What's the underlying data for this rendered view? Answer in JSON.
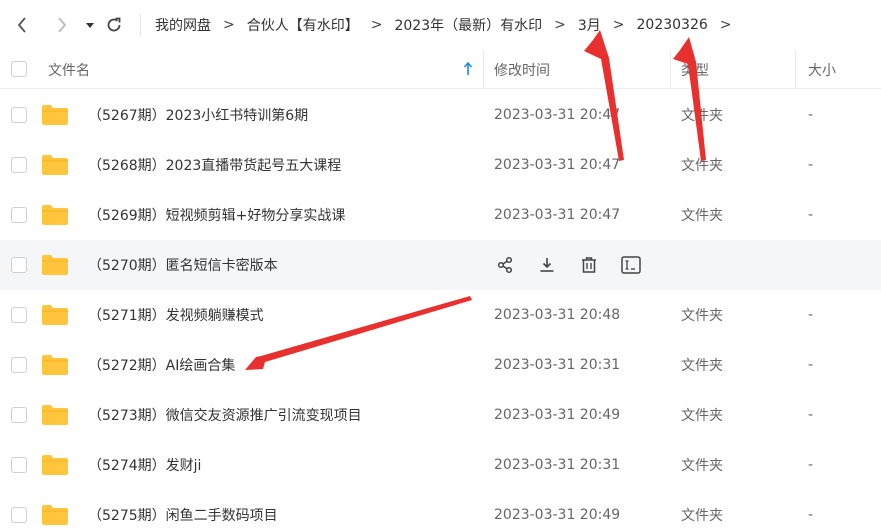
{
  "breadcrumb": {
    "items": [
      "我的网盘",
      "合伙人【有水印】",
      "2023年（最新）有水印",
      "3月",
      "20230326"
    ],
    "separator": ">"
  },
  "columns": {
    "name": "文件名",
    "time": "修改时间",
    "type": "类型",
    "size": "大小"
  },
  "rows": [
    {
      "name": "（5267期）2023小红书特训第6期",
      "time": "2023-03-31 20:47",
      "type": "文件夹",
      "size": "-"
    },
    {
      "name": "（5268期）2023直播带货起号五大课程",
      "time": "2023-03-31 20:47",
      "type": "文件夹",
      "size": "-"
    },
    {
      "name": "（5269期）短视频剪辑+好物分享实战课",
      "time": "2023-03-31 20:47",
      "type": "文件夹",
      "size": "-"
    },
    {
      "name": "（5270期）匿名短信卡密版本",
      "time": "",
      "type": "",
      "size": ""
    },
    {
      "name": "（5271期）发视频躺赚模式",
      "time": "2023-03-31 20:48",
      "type": "文件夹",
      "size": "-"
    },
    {
      "name": "（5272期）AI绘画合集",
      "time": "2023-03-31 20:31",
      "type": "文件夹",
      "size": "-"
    },
    {
      "name": "（5273期）微信交友资源推广引流变现项目",
      "time": "2023-03-31 20:49",
      "type": "文件夹",
      "size": "-"
    },
    {
      "name": "（5274期）发财ji",
      "time": "2023-03-31 20:31",
      "type": "文件夹",
      "size": "-"
    },
    {
      "name": "（5275期）闲鱼二手数码项目",
      "time": "2023-03-31 20:49",
      "type": "文件夹",
      "size": "-"
    }
  ],
  "hover_actions": [
    "share-icon",
    "download-icon",
    "delete-icon",
    "rename-icon"
  ],
  "colors": {
    "folder": "#ffc53d",
    "folder_dark": "#f5b31a",
    "arrow": "#e8312f",
    "link_blue": "#1e88e5",
    "hover_row": "#f5f6f8"
  }
}
